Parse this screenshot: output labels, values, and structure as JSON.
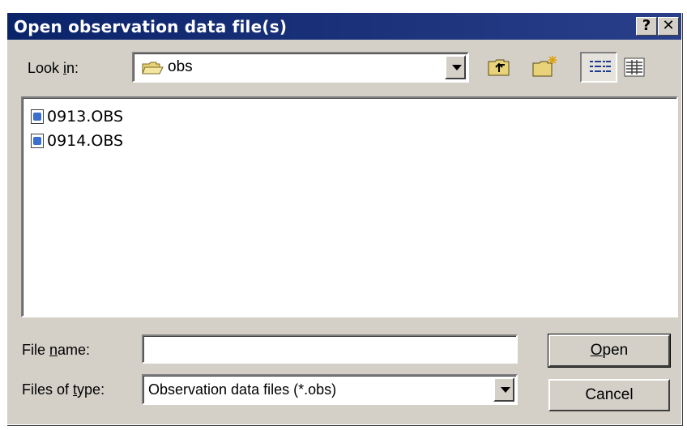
{
  "window": {
    "title": "Open observation data file(s)",
    "help_label": "?",
    "close_label": "✕"
  },
  "look_in": {
    "label_pre": "Look ",
    "label_accel": "i",
    "label_post": "n:",
    "value": "obs"
  },
  "files": [
    {
      "name": "0913.OBS"
    },
    {
      "name": "0914.OBS"
    }
  ],
  "file_name": {
    "label_pre": "File ",
    "label_accel": "n",
    "label_post": "ame:",
    "value": ""
  },
  "file_type": {
    "label_pre": "Files of ",
    "label_accel": "t",
    "label_post": "ype:",
    "value": "Observation data files (*.obs)"
  },
  "buttons": {
    "open_accel": "O",
    "open_rest": "pen",
    "cancel": "Cancel"
  },
  "icons": {
    "folder": "folder-icon",
    "up_one_level": "up-one-level-icon",
    "new_folder": "new-folder-icon",
    "list_view": "list-view-icon",
    "details_view": "details-view-icon",
    "file": "obs-file-icon"
  }
}
